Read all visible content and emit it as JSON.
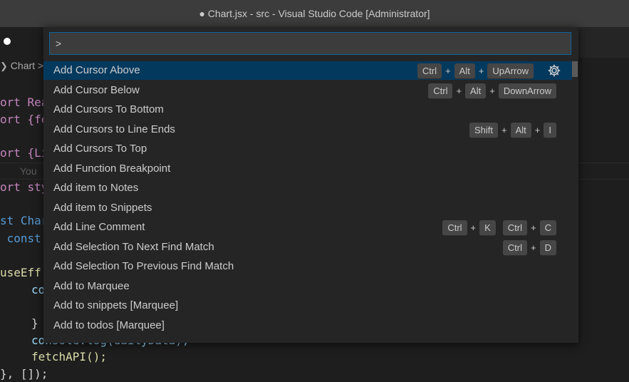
{
  "window": {
    "title": "● Chart.jsx - src - Visual Studio Code [Administrator]"
  },
  "editor": {
    "breadcrumb": "Chart >",
    "code": [
      {
        "text": "ort Rea"
      },
      {
        "text": "ort {fe"
      },
      {
        "text": "ort {Li"
      },
      {
        "text": "You"
      },
      {
        "text": "ort sty"
      },
      {
        "text": "st Char"
      },
      {
        "text": " const"
      },
      {
        "text": "useEff"
      },
      {
        "text": "co"
      },
      {
        "text": "}"
      },
      {
        "text": "console.log(dailyData);"
      },
      {
        "text": "fetchAPI();"
      },
      {
        "text": "}, []);"
      }
    ]
  },
  "palette": {
    "input_value": ">",
    "items": [
      {
        "label": "Add Cursor Above",
        "keys": [
          [
            "Ctrl",
            "Alt",
            "UpArrow"
          ]
        ]
      },
      {
        "label": "Add Cursor Below",
        "keys": [
          [
            "Ctrl",
            "Alt",
            "DownArrow"
          ]
        ]
      },
      {
        "label": "Add Cursors To Bottom",
        "keys": []
      },
      {
        "label": "Add Cursors to Line Ends",
        "keys": [
          [
            "Shift",
            "Alt",
            "I"
          ]
        ]
      },
      {
        "label": "Add Cursors To Top",
        "keys": []
      },
      {
        "label": "Add Function Breakpoint",
        "keys": []
      },
      {
        "label": "Add item to Notes",
        "keys": []
      },
      {
        "label": "Add item to Snippets",
        "keys": []
      },
      {
        "label": "Add Line Comment",
        "keys": [
          [
            "Ctrl",
            "K"
          ],
          [
            "Ctrl",
            "C"
          ]
        ]
      },
      {
        "label": "Add Selection To Next Find Match",
        "keys": [
          [
            "Ctrl",
            "D"
          ]
        ]
      },
      {
        "label": "Add Selection To Previous Find Match",
        "keys": []
      },
      {
        "label": "Add to Marquee",
        "keys": []
      },
      {
        "label": "Add to snippets [Marquee]",
        "keys": []
      },
      {
        "label": "Add to todos [Marquee]",
        "keys": []
      }
    ]
  }
}
